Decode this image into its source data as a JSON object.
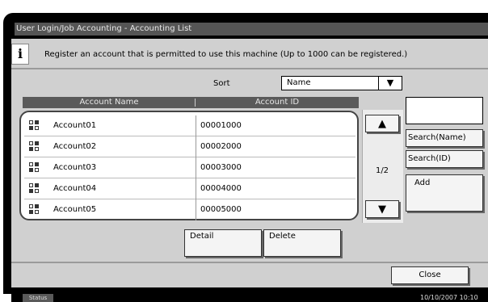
{
  "window": {
    "title": "User Login/Job Accounting - Accounting List"
  },
  "info": {
    "icon": "info-icon",
    "icon_glyph": "i",
    "message": "Register an account that is permitted to use this machine (Up to 1000 can be registered.)"
  },
  "sort": {
    "label": "Sort",
    "value": "Name",
    "arrow": "▼"
  },
  "table": {
    "columns": [
      "Account Name",
      "Account ID"
    ],
    "rows": [
      {
        "name": "Account01",
        "id": "00001000"
      },
      {
        "name": "Account02",
        "id": "00002000"
      },
      {
        "name": "Account03",
        "id": "00003000"
      },
      {
        "name": "Account04",
        "id": "00004000"
      },
      {
        "name": "Account05",
        "id": "00005000"
      }
    ]
  },
  "scroll": {
    "up": "▲",
    "down": "▼",
    "page": "1/2"
  },
  "search": {
    "value": "",
    "by_name": "Search(Name)",
    "by_id": "Search(ID)",
    "add": "Add"
  },
  "actions": {
    "detail": "Detail",
    "delete": "Delete",
    "close": "Close"
  },
  "status": {
    "tab": "Status",
    "datetime": "10/10/2007  10:10"
  }
}
